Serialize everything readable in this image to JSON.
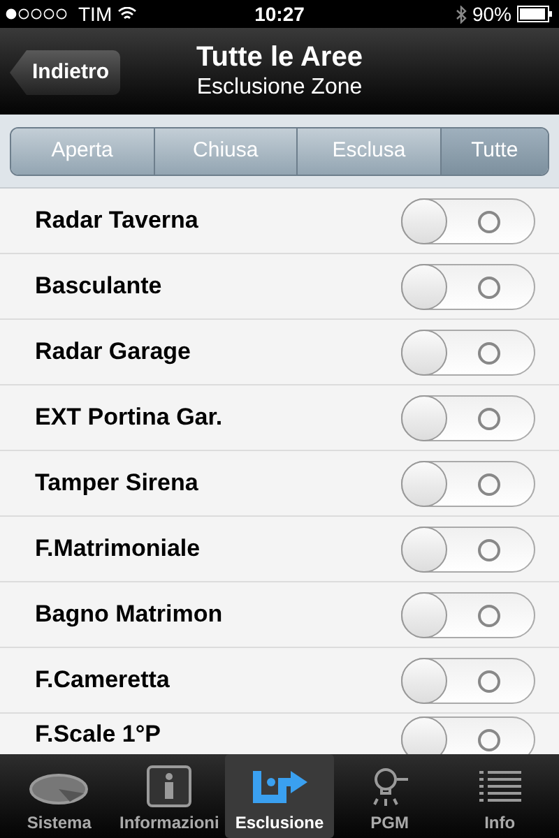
{
  "status_bar": {
    "carrier": "TIM",
    "time": "10:27",
    "battery": "90%"
  },
  "nav": {
    "back": "Indietro",
    "title": "Tutte le Aree",
    "subtitle": "Esclusione Zone"
  },
  "segments": [
    {
      "label": "Aperta",
      "selected": false
    },
    {
      "label": "Chiusa",
      "selected": false
    },
    {
      "label": "Esclusa",
      "selected": false
    },
    {
      "label": "Tutte",
      "selected": true
    }
  ],
  "zones": [
    {
      "name": "Radar Taverna",
      "on": false
    },
    {
      "name": "Basculante",
      "on": false
    },
    {
      "name": "Radar Garage",
      "on": false
    },
    {
      "name": "EXT Portina Gar.",
      "on": false
    },
    {
      "name": "Tamper Sirena",
      "on": false
    },
    {
      "name": "F.Matrimoniale",
      "on": false
    },
    {
      "name": "Bagno Matrimon",
      "on": false
    },
    {
      "name": "F.Cameretta",
      "on": false
    },
    {
      "name": "F.Scale 1°P",
      "on": false
    }
  ],
  "tabs": [
    {
      "label": "Sistema",
      "kind": "disc",
      "selected": false
    },
    {
      "label": "Informazioni",
      "kind": "info",
      "selected": false
    },
    {
      "label": "Esclusione",
      "kind": "bypass",
      "selected": true
    },
    {
      "label": "PGM",
      "kind": "bulb",
      "selected": false
    },
    {
      "label": "Info",
      "kind": "list",
      "selected": false
    }
  ]
}
